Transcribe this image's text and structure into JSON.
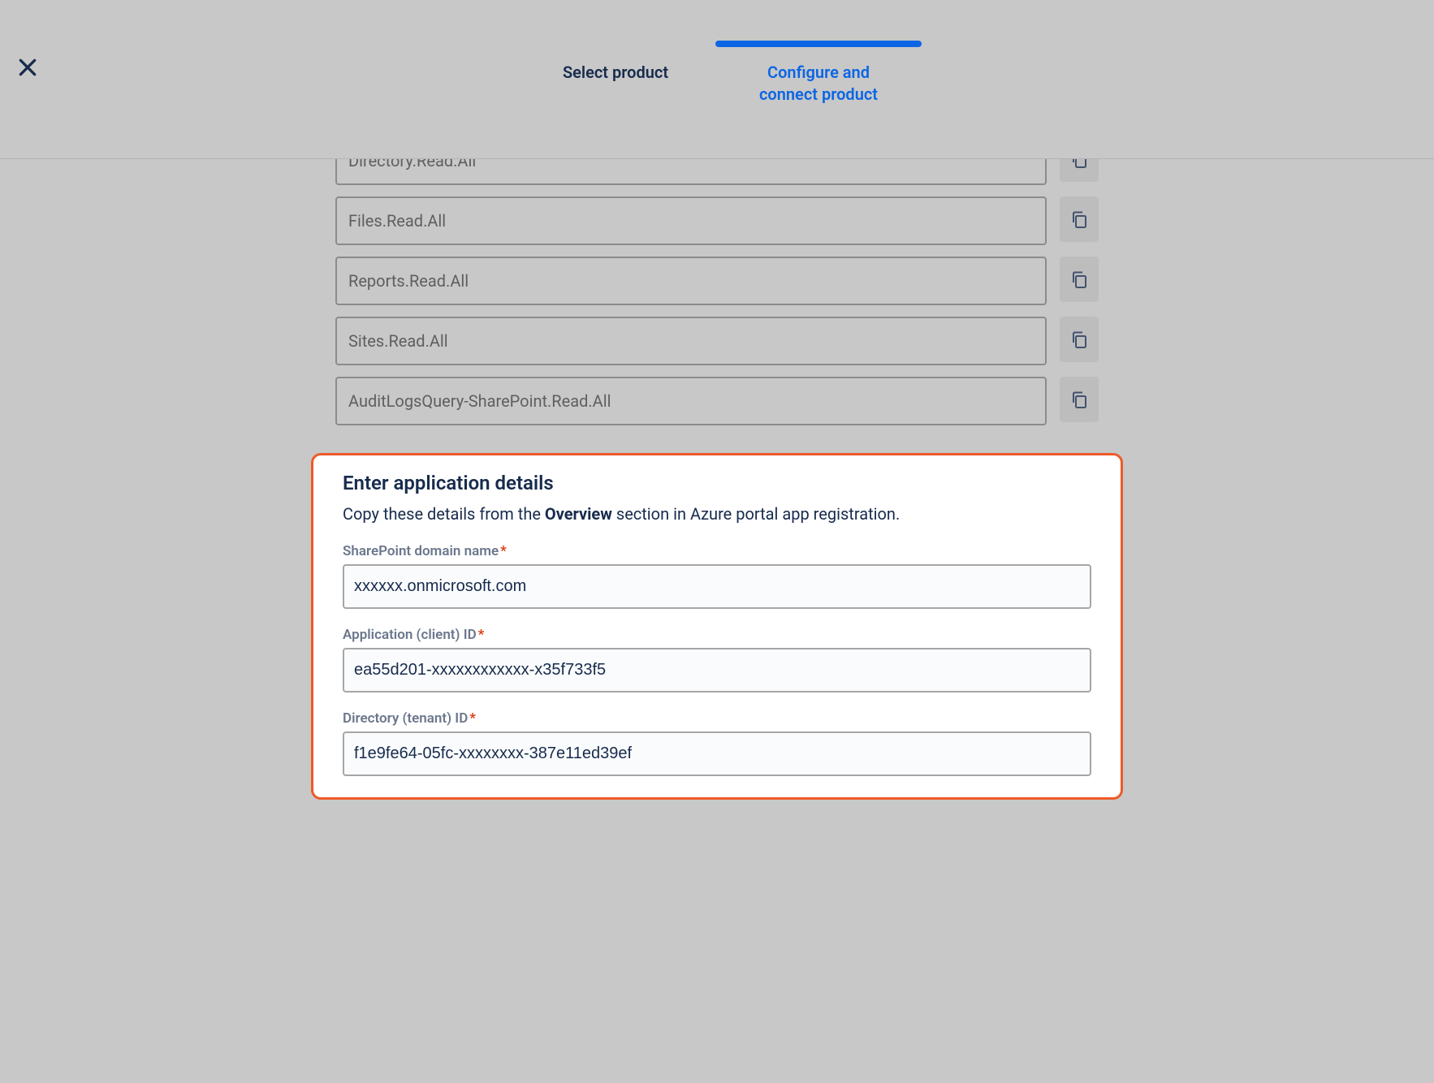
{
  "steps": {
    "select": "Select product",
    "configure": "Configure and connect product"
  },
  "permissions": [
    "Directory.Read.All",
    "Files.Read.All",
    "Reports.Read.All",
    "Sites.Read.All",
    "AuditLogsQuery-SharePoint.Read.All"
  ],
  "details": {
    "heading": "Enter application details",
    "sub_pre": "Copy these details from the ",
    "sub_bold": "Overview",
    "sub_post": " section in Azure portal app registration.",
    "fields": {
      "domain": {
        "label": "SharePoint domain name",
        "value": "xxxxxx.onmicrosoft.com"
      },
      "client": {
        "label": "Application (client) ID",
        "value": "ea55d201-xxxxxxxxxxxx-x35f733f5"
      },
      "tenant": {
        "label": "Directory (tenant) ID",
        "value": "f1e9fe64-05fc-xxxxxxxx-387e11ed39ef"
      }
    }
  }
}
